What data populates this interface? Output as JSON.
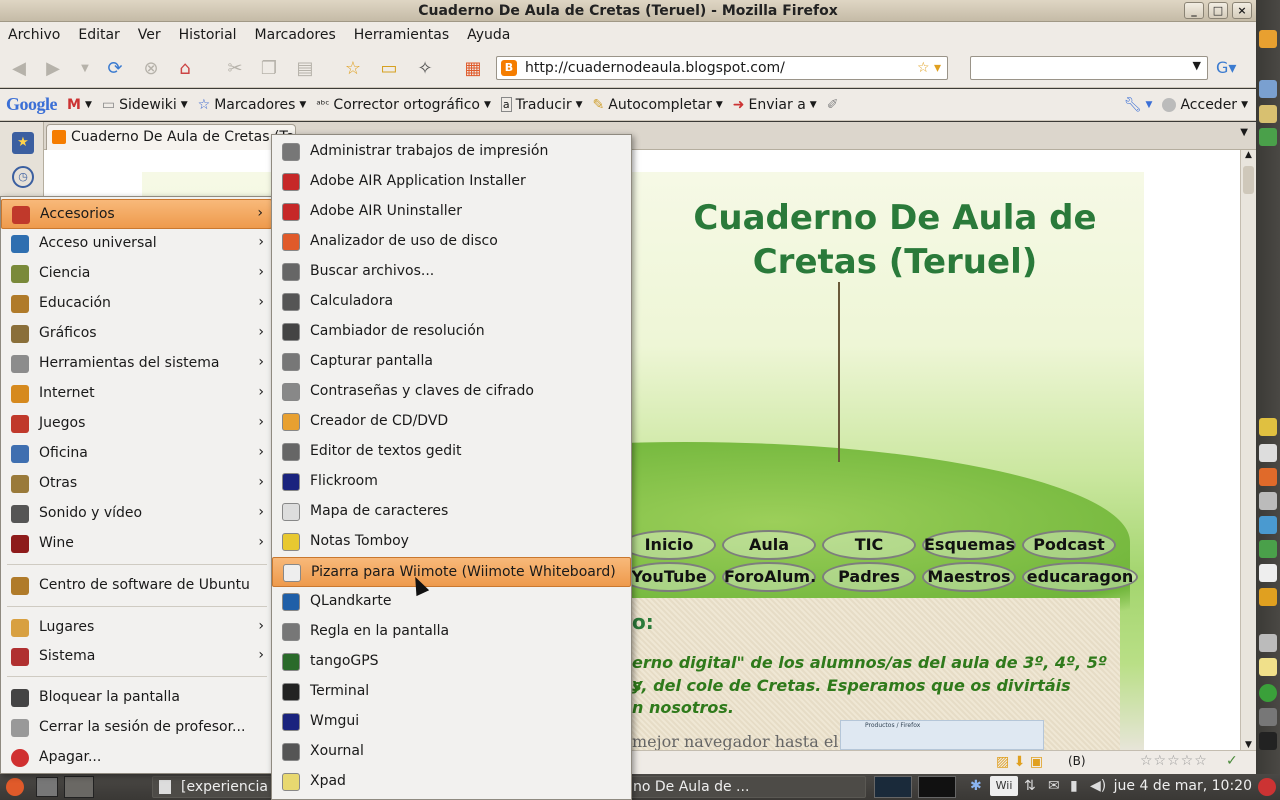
{
  "window": {
    "title": "Cuaderno De Aula de Cretas (Teruel) - Mozilla Firefox",
    "buttons": [
      "_",
      "□",
      "×"
    ]
  },
  "menubar": [
    "Archivo",
    "Editar",
    "Ver",
    "Historial",
    "Marcadores",
    "Herramientas",
    "Ayuda"
  ],
  "address": {
    "url": "http://cuadernodeaula.blogspot.com/",
    "favicon": "B"
  },
  "google_toolbar": {
    "logo": "Google",
    "sidewiki": "Sidewiki",
    "bookmarks": "Marcadores",
    "spell": "Corrector ortográfico",
    "translate": "Traducir",
    "autofill": "Autocompletar",
    "send": "Enviar a",
    "signin": "Acceder"
  },
  "tab": {
    "title": "Cuaderno De Aula de Cretas (Te"
  },
  "page": {
    "blog_title_line1": "Cuaderno De Aula de",
    "blog_title_line2": "Cretas (Teruel)",
    "nav_row1": [
      "Inicio",
      "Aula",
      "TIC",
      "Esquemas",
      "Podcast"
    ],
    "nav_row2": [
      "YouTube",
      "ForoAlum.",
      "Padres",
      "Maestros",
      "educaragon"
    ],
    "colon": "o:",
    "line1": "erno digital\" de los alumnos/as del aula de 3º, 4º, 5º y",
    "line2": "s,  del  cole  de  Cretas.  Esperamos  que  os  divirtáis",
    "line3": "n nosotros.",
    "faded_line": "mejor navegador hasta el",
    "ad_title": "Productos / Firefox"
  },
  "menu_apps": {
    "items": [
      {
        "label": "Accesorios",
        "icon": "accessories-icon",
        "color": "#c0392b",
        "submenu": true
      },
      {
        "label": "Acceso universal",
        "icon": "universal-access-icon",
        "color": "#2f6fb0",
        "submenu": true
      },
      {
        "label": "Ciencia",
        "icon": "science-icon",
        "color": "#7a8a3a",
        "submenu": true
      },
      {
        "label": "Educación",
        "icon": "education-icon",
        "color": "#b07b2a",
        "submenu": true
      },
      {
        "label": "Gráficos",
        "icon": "graphics-icon",
        "color": "#8a6f3a",
        "submenu": true
      },
      {
        "label": "Herramientas del sistema",
        "icon": "system-tools-icon",
        "color": "#8c8c8c",
        "submenu": true
      },
      {
        "label": "Internet",
        "icon": "internet-icon",
        "color": "#d68a1e",
        "submenu": true
      },
      {
        "label": "Juegos",
        "icon": "games-icon",
        "color": "#c0392b",
        "submenu": true
      },
      {
        "label": "Oficina",
        "icon": "office-icon",
        "color": "#3f6fb0",
        "submenu": true
      },
      {
        "label": "Otras",
        "icon": "other-icon",
        "color": "#9a7a3a",
        "submenu": true
      },
      {
        "label": "Sonido y vídeo",
        "icon": "multimedia-icon",
        "color": "#555555",
        "submenu": true
      },
      {
        "label": "Wine",
        "icon": "wine-icon",
        "color": "#8e1b1b",
        "submenu": true
      }
    ],
    "software_center": "Centro de software de Ubuntu",
    "places": "Lugares",
    "system": "Sistema",
    "lock": "Bloquear la pantalla",
    "logout": "Cerrar la sesión de profesor...",
    "shutdown": "Apagar..."
  },
  "menu_accessories": {
    "items": [
      {
        "label": "Administrar trabajos de impresión",
        "icon": "printer-icon",
        "color": "#777777"
      },
      {
        "label": "Adobe AIR Application Installer",
        "icon": "adobe-air-icon",
        "color": "#c62828"
      },
      {
        "label": "Adobe AIR Uninstaller",
        "icon": "adobe-air-icon",
        "color": "#c62828"
      },
      {
        "label": "Analizador de uso de disco",
        "icon": "disk-usage-icon",
        "color": "#e05a2a"
      },
      {
        "label": "Buscar archivos...",
        "icon": "search-icon",
        "color": "#666666"
      },
      {
        "label": "Calculadora",
        "icon": "calculator-icon",
        "color": "#555555"
      },
      {
        "label": "Cambiador de resolución",
        "icon": "display-icon",
        "color": "#444444"
      },
      {
        "label": "Capturar pantalla",
        "icon": "camera-icon",
        "color": "#777777"
      },
      {
        "label": "Contraseñas y claves de cifrado",
        "icon": "keys-icon",
        "color": "#888888"
      },
      {
        "label": "Creador de CD/DVD",
        "icon": "disc-icon",
        "color": "#e8a030"
      },
      {
        "label": "Editor de textos gedit",
        "icon": "text-editor-icon",
        "color": "#666666"
      },
      {
        "label": "Flickroom",
        "icon": "flickroom-icon",
        "color": "#1a237e"
      },
      {
        "label": "Mapa de caracteres",
        "icon": "charmap-icon",
        "color": "#dddddd"
      },
      {
        "label": "Notas Tomboy",
        "icon": "notes-icon",
        "color": "#e8c830"
      },
      {
        "label": "Pizarra para Wiimote (Wiimote Whiteboard)",
        "icon": "wii-icon",
        "color": "#eeeeee"
      },
      {
        "label": "QLandkarte",
        "icon": "qlandkarte-icon",
        "color": "#1f5fa8"
      },
      {
        "label": "Regla en la pantalla",
        "icon": "ruler-icon",
        "color": "#777777"
      },
      {
        "label": "tangoGPS",
        "icon": "gps-icon",
        "color": "#2a6a2a"
      },
      {
        "label": "Terminal",
        "icon": "terminal-icon",
        "color": "#222222"
      },
      {
        "label": "Wmgui",
        "icon": "wmgui-icon",
        "color": "#1a237e"
      },
      {
        "label": "Xournal",
        "icon": "xournal-icon",
        "color": "#555555"
      },
      {
        "label": "Xpad",
        "icon": "xpad-icon",
        "color": "#e8d870"
      }
    ],
    "highlighted_index": 14
  },
  "taskbar": {
    "item1": "[experiencia",
    "item2": "no De Aula de ...",
    "clock": "jue  4 de mar, 10:20",
    "wii": "Wii"
  }
}
